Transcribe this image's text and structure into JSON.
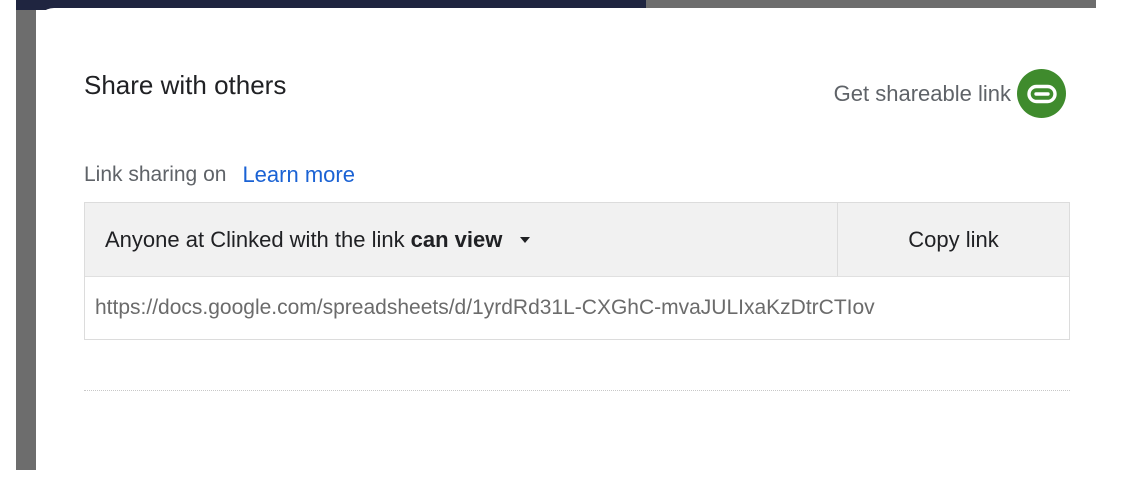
{
  "dialog": {
    "title": "Share with others",
    "get_link_label": "Get shareable link",
    "link_icon": "link-icon",
    "accent_color": "#3f8b2d"
  },
  "link_sharing": {
    "status": "Link sharing on",
    "learn_more": "Learn more",
    "access_prefix": "Anyone at Clinked with the link",
    "access_level": "can view",
    "copy_link": "Copy link",
    "url": "https://docs.google.com/spreadsheets/d/1yrdRd31L-CXGhC-mvaJULIxaKzDtrCTIov"
  }
}
